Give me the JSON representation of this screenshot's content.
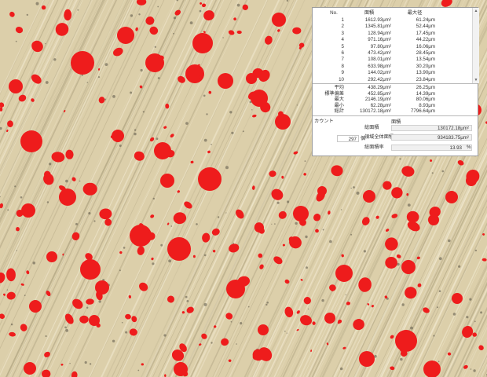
{
  "colors": {
    "particle": "#ee1c1c",
    "background": "#dccfaa"
  },
  "table": {
    "headers": [
      "No.",
      "面積",
      "最大径"
    ],
    "rows": [
      [
        "1",
        "1612.93μm²",
        "61.24μm"
      ],
      [
        "2",
        "1345.81μm²",
        "52.44μm"
      ],
      [
        "3",
        "128.94μm²",
        "17.45μm"
      ],
      [
        "4",
        "971.16μm²",
        "44.22μm"
      ],
      [
        "5",
        "97.80μm²",
        "16.06μm"
      ],
      [
        "6",
        "473.42μm²",
        "28.45μm"
      ],
      [
        "7",
        "108.01μm²",
        "13.54μm"
      ],
      [
        "8",
        "633.98μm²",
        "30.20μm"
      ],
      [
        "9",
        "144.02μm²",
        "13.90μm"
      ],
      [
        "10",
        "292.42μm²",
        "23.84μm"
      ]
    ],
    "stats": [
      [
        "平均",
        "438.29μm²",
        "26.25μm"
      ],
      [
        "標準偏差",
        "452.85μm²",
        "14.39μm"
      ],
      [
        "最大",
        "2146.19μm²",
        "80.06μm"
      ],
      [
        "最小",
        "62.28μm²",
        "8.93μm"
      ],
      [
        "総計",
        "130172.18μm²",
        "7796.64μm"
      ]
    ]
  },
  "count": {
    "title": "カウント",
    "value": "297",
    "unit": "個"
  },
  "area": {
    "title": "面積",
    "total_label": "総面積",
    "total_value": "130172.18μm²",
    "region_label": "領域全体面積",
    "region_value": "934183.75μm²",
    "ratio_label": "総面積率",
    "ratio_value": "13.93",
    "ratio_unit": "%"
  },
  "scroll_icons": {
    "up": "▲",
    "down": "▼"
  }
}
